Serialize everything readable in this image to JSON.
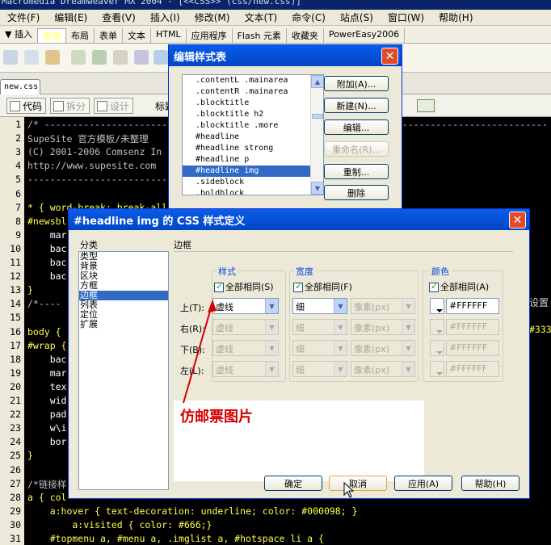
{
  "app": {
    "title": "Macromedia Dreamweaver MX 2004 - [<<CSS>> (css/new.css)]"
  },
  "menu": [
    "文件(F)",
    "编辑(E)",
    "查看(V)",
    "插入(I)",
    "修改(M)",
    "文本(T)",
    "命令(C)",
    "站点(S)",
    "窗口(W)",
    "帮助(H)"
  ],
  "insert": {
    "label": "▼ 插入",
    "tabs": [
      "常用",
      "布局",
      "表单",
      "文本",
      "HTML",
      "应用程序",
      "Flash 元素",
      "收藏夹",
      "PowerEasy2006"
    ],
    "selected": 0
  },
  "document": {
    "tab": "new.css"
  },
  "viewbar": {
    "code": "代码",
    "split": "拆分",
    "design": "设计",
    "title_label": "标题"
  },
  "code_lines": [
    {
      "n": "1",
      "t": "/* ------------------------------------------------------------------------------------------",
      "c": "cm"
    },
    {
      "n": "2",
      "t": "SupeSite 官方模板/未整理",
      "c": "cm"
    },
    {
      "n": "3",
      "t": "(C) 2001-2006 Comsenz In",
      "c": "cm"
    },
    {
      "n": "4",
      "t": "http://www.supesite.com",
      "c": "cm"
    },
    {
      "n": "5",
      "t": "-------------------------",
      "c": "cm"
    },
    {
      "n": "6",
      "t": "",
      "c": "cm"
    },
    {
      "n": "7",
      "t": "* { word-break: break-all",
      "c": "sel"
    },
    {
      "n": "8",
      "t": "#newsbl",
      "c": "sel"
    },
    {
      "n": "9",
      "t": "    mar",
      "c": "prp"
    },
    {
      "n": "10",
      "t": "    bac",
      "c": "prp"
    },
    {
      "n": "11",
      "t": "    bac",
      "c": "prp"
    },
    {
      "n": "12",
      "t": "    bac",
      "c": "prp"
    },
    {
      "n": "13",
      "t": "}",
      "c": "sel"
    },
    {
      "n": "14",
      "t": "/*----",
      "c": "cm"
    },
    {
      "n": "15",
      "t": "",
      "c": "cm"
    },
    {
      "n": "16",
      "t": "body {",
      "c": "sel"
    },
    {
      "n": "17",
      "t": "#wrap {",
      "c": "sel"
    },
    {
      "n": "18",
      "t": "    bac",
      "c": "prp"
    },
    {
      "n": "19",
      "t": "    mar",
      "c": "prp"
    },
    {
      "n": "20",
      "t": "    tex",
      "c": "prp"
    },
    {
      "n": "21",
      "t": "    wid",
      "c": "prp"
    },
    {
      "n": "22",
      "t": "    pad",
      "c": "prp"
    },
    {
      "n": "23",
      "t": "    w\\i",
      "c": "prp"
    },
    {
      "n": "24",
      "t": "    bor",
      "c": "prp"
    },
    {
      "n": "25",
      "t": "}",
      "c": "sel"
    },
    {
      "n": "26",
      "t": "",
      "c": "cm"
    },
    {
      "n": "27",
      "t": "/*链接样",
      "c": "cm"
    },
    {
      "n": "28",
      "t": "a { col",
      "c": "sel"
    },
    {
      "n": "29",
      "t": "    a:hover { text-decoration: underline; color: #000098; }",
      "c": "sel"
    },
    {
      "n": "30",
      "t": "        a:visited { color: #666;}",
      "c": "sel"
    },
    {
      "n": "31",
      "t": "    #topmenu a, #menu a, .imglist a, #hotspace li a {",
      "c": "sel"
    }
  ],
  "code_right": {
    "line14": "设置",
    "line16": "#333"
  },
  "edit_dialog": {
    "title": "编辑样式表",
    "items": [
      ".contentL .mainarea",
      ".contentR .mainarea",
      ".blocktitle",
      ".blocktitle h2",
      ".blocktitle .more",
      "#headline",
      "#headline strong",
      "#headline p",
      "#headline img",
      ".sideblock",
      ".boldblock"
    ],
    "selected_index": 8,
    "buttons": {
      "attach": "附加(A)...",
      "new": "新建(N)...",
      "edit": "编辑...",
      "rename": "重命名(R)...",
      "duplicate": "重制...",
      "delete": "删除"
    }
  },
  "css_dialog": {
    "title": "#headline img 的 CSS 样式定义",
    "category_label": "分类",
    "categories": [
      "类型",
      "背景",
      "区块",
      "方框",
      "边框",
      "列表",
      "定位",
      "扩展"
    ],
    "selected_category": 4,
    "section": "边框",
    "style_group": "样式",
    "width_group": "宽度",
    "color_group": "颜色",
    "same_all": "全部相同(S)",
    "same_all_width": "全部相同(F)",
    "same_all_color": "全部相同(A)",
    "rows": [
      {
        "label": "上(T):",
        "style": "虚线",
        "width": "细",
        "unit": "像素(px)",
        "color": "#FFFFFF"
      },
      {
        "label": "右(R):",
        "style": "虚线",
        "width": "细",
        "unit": "像素(px)",
        "color": "#FFFFFF"
      },
      {
        "label": "下(B):",
        "style": "虚线",
        "width": "细",
        "unit": "像素(px)",
        "color": "#FFFFFF"
      },
      {
        "label": "左(L):",
        "style": "虚线",
        "width": "细",
        "unit": "像素(px)",
        "color": "#FFFFFF"
      }
    ],
    "annotation": "仿邮票图片",
    "buttons": {
      "ok": "确定",
      "cancel": "取消",
      "apply": "应用(A)",
      "help": "帮助(H)"
    }
  }
}
